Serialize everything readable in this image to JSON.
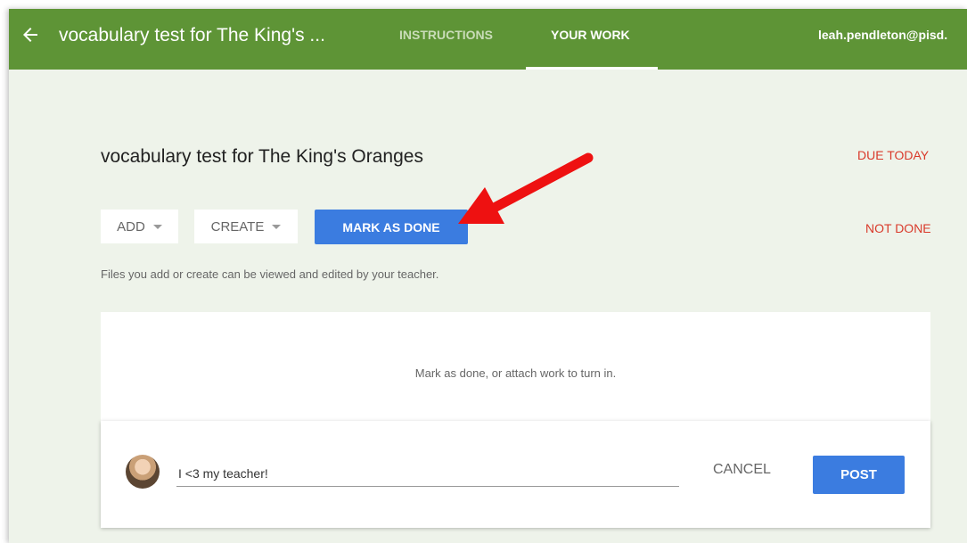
{
  "header": {
    "title": "vocabulary test for The King's ...",
    "tabs": [
      {
        "label": "INSTRUCTIONS"
      },
      {
        "label": "YOUR WORK"
      }
    ],
    "account": "leah.pendleton@pisd.",
    "colors": {
      "bar": "#5e9436",
      "inactive_tab": "#c9dcb8"
    }
  },
  "assignment": {
    "title": "vocabulary test for The King's Oranges",
    "due": "DUE TODAY",
    "status": "NOT DONE"
  },
  "toolbar": {
    "add_label": "ADD",
    "create_label": "CREATE",
    "mark_done_label": "MARK AS DONE"
  },
  "helper_text": "Files you add or create can be viewed and edited by your teacher.",
  "work": {
    "empty_message": "Mark as done, or attach work to turn in."
  },
  "comment": {
    "value": "I <3 my teacher!",
    "cancel_label": "CANCEL",
    "post_label": "POST"
  },
  "icons": {
    "back": "arrow-back-icon",
    "dropdown": "caret-down-icon",
    "annotation": "red-arrow-icon"
  },
  "accent_colors": {
    "primary": "#3b7ce0",
    "alert": "#d93a2b"
  }
}
